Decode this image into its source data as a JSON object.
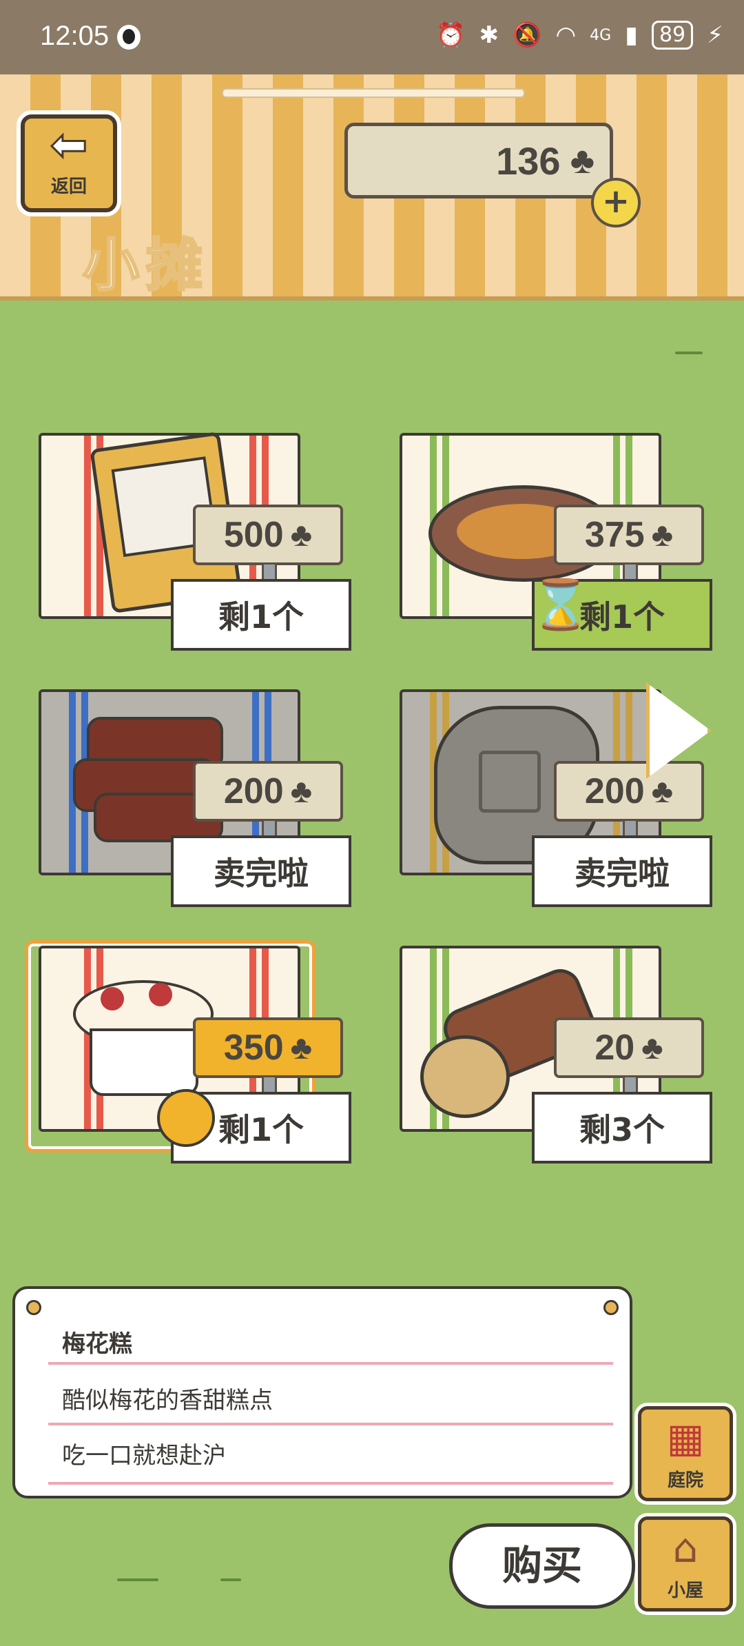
{
  "status_bar": {
    "time": "12:05",
    "icons": [
      "alarm-icon",
      "bluetooth-icon",
      "mute-icon",
      "wifi-icon",
      "4g-signal-icon"
    ],
    "network": "4G",
    "battery": "89"
  },
  "header": {
    "back_label": "返回",
    "coins": "136",
    "currency_icon": "clover",
    "title": "小摊"
  },
  "items": [
    {
      "price": "500",
      "qty": "剩1个",
      "art": "furniture-catalog",
      "sold_out": false
    },
    {
      "price": "375",
      "qty": "剩1个",
      "art": "pancake-plate",
      "sold_out": false,
      "timed": true
    },
    {
      "price": "200",
      "qty": "卖完啦",
      "art": "wood-logs",
      "sold_out": true
    },
    {
      "price": "200",
      "qty": "卖完啦",
      "art": "stone",
      "sold_out": true
    },
    {
      "price": "350",
      "qty": "剩1个",
      "art": "plum-cake",
      "sold_out": false,
      "selected": true
    },
    {
      "price": "20",
      "qty": "剩3个",
      "art": "log",
      "sold_out": false
    }
  ],
  "description": {
    "name": "梅花糕",
    "line1": "酷似梅花的香甜糕点",
    "line2": "吃一口就想赴沪"
  },
  "side_buttons": {
    "yard": "庭院",
    "house": "小屋"
  },
  "buy_label": "购买",
  "colors": {
    "grass": "#9cc36a",
    "awning_light": "#f5d7a8",
    "awning_dark": "#e7b558",
    "price_highlight": "#f1b22c",
    "timed_qty": "#a7c955"
  }
}
